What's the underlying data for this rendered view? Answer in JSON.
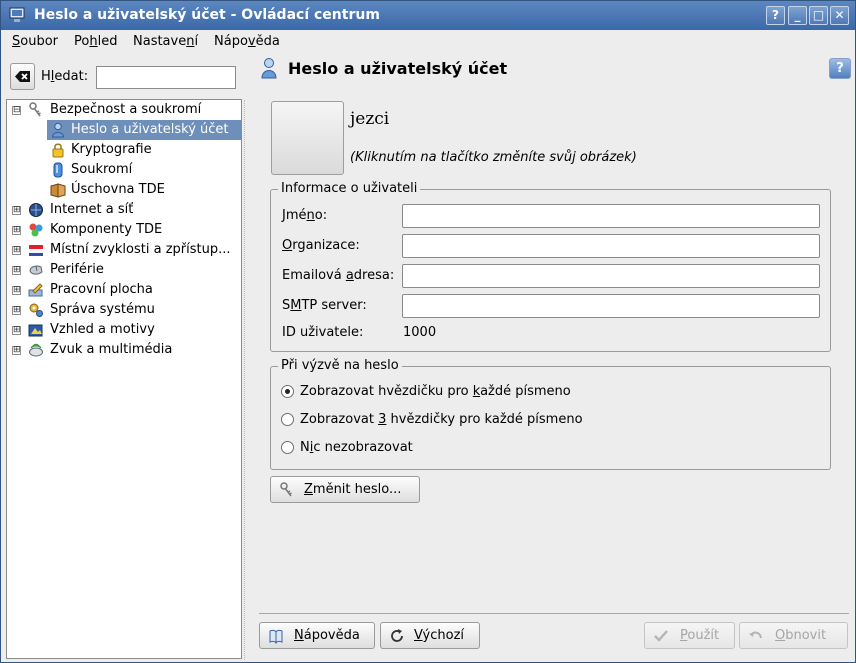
{
  "window": {
    "title": "Heslo a uživatelský účet - Ovládací centrum"
  },
  "titlebar_buttons": {
    "help": "?",
    "minimize": "_",
    "maximize": "□",
    "close": "✕"
  },
  "menu": [
    {
      "pre": "",
      "acc": "S",
      "post": "oubor"
    },
    {
      "pre": "Po",
      "acc": "h",
      "post": "led"
    },
    {
      "pre": "Nastave",
      "acc": "n",
      "post": "í"
    },
    {
      "pre": "Nápo",
      "acc": "v",
      "post": "ěda"
    }
  ],
  "search": {
    "pre": "H",
    "acc": "l",
    "post": "edat:",
    "value": ""
  },
  "tree": [
    {
      "label": "Bezpečnost a soukromí",
      "icon": "keys-icon",
      "expander": "⊟"
    },
    {
      "label": "Heslo a uživatelský účet",
      "icon": "user-icon",
      "selected": true
    },
    {
      "label": "Kryptografie",
      "icon": "lock-icon"
    },
    {
      "label": "Soukromí",
      "icon": "privacy-icon"
    },
    {
      "label": "Úschovna TDE",
      "icon": "wallet-icon"
    },
    {
      "label": "Internet a síť",
      "icon": "globe-icon",
      "expander": "⊞"
    },
    {
      "label": "Komponenty TDE",
      "icon": "components-icon",
      "expander": "⊞"
    },
    {
      "label": "Místní zvyklosti a zpřístup...",
      "icon": "flag-icon",
      "expander": "⊞"
    },
    {
      "label": "Periférie",
      "icon": "mouse-icon",
      "expander": "⊞"
    },
    {
      "label": "Pracovní plocha",
      "icon": "desktop-icon",
      "expander": "⊞"
    },
    {
      "label": "Správa systému",
      "icon": "gears-icon",
      "expander": "⊞"
    },
    {
      "label": "Vzhled a motivy",
      "icon": "theme-icon",
      "expander": "⊞"
    },
    {
      "label": "Zvuk a multimédia",
      "icon": "sound-icon",
      "expander": "⊞"
    }
  ],
  "page": {
    "title": "Heslo a uživatelský účet",
    "help_button": "?",
    "username": "jezci",
    "face_hint": "(Kliknutím na tlačítko změníte svůj obrázek)"
  },
  "user_info": {
    "title": "Informace o uživateli",
    "fields": [
      {
        "pre": "Jmé",
        "acc": "n",
        "post": "o:",
        "value": ""
      },
      {
        "pre": "",
        "acc": "O",
        "post": "rganizace:",
        "value": ""
      },
      {
        "pre": "Emailová ",
        "acc": "a",
        "post": "dresa:",
        "value": ""
      },
      {
        "pre": "S",
        "acc": "M",
        "post": "TP server:",
        "value": ""
      }
    ],
    "id_label": "ID uživatele:",
    "id_value": "1000"
  },
  "password_prompt": {
    "title": "Při výzvě na heslo",
    "options": [
      {
        "pre": "Zobrazovat hvězdičku pro ",
        "acc": "k",
        "post": "aždé písmeno",
        "checked": true
      },
      {
        "pre": "Zobrazovat ",
        "acc": "3",
        "post": " hvězdičky pro každé písmeno",
        "checked": false
      },
      {
        "pre": "N",
        "acc": "i",
        "post": "c nezobrazovat",
        "checked": false
      }
    ]
  },
  "change_password": {
    "pre": "",
    "acc": "Z",
    "post": "měnit heslo..."
  },
  "bottom_buttons": {
    "help": {
      "pre": "",
      "acc": "N",
      "post": "ápověda"
    },
    "defaults": {
      "pre": "",
      "acc": "V",
      "post": "ýchozí"
    },
    "apply": {
      "pre": "",
      "acc": "P",
      "post": "oužít"
    },
    "reset": {
      "pre": "",
      "acc": "O",
      "post": "bnovit"
    }
  }
}
